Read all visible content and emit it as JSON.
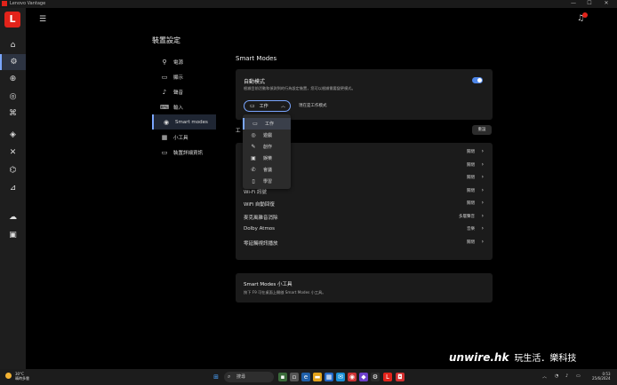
{
  "window": {
    "title": "Lenovo Vantage",
    "brand_letter": "L",
    "min": "—",
    "max": "☐",
    "close": "✕"
  },
  "page": {
    "title": "裝置設定"
  },
  "nav": [
    {
      "icon": "⚲",
      "label": "電源"
    },
    {
      "icon": "▭",
      "label": "顯示"
    },
    {
      "icon": "♪",
      "label": "聲音"
    },
    {
      "icon": "⌨",
      "label": "輸入"
    },
    {
      "icon": "◉",
      "label": "Smart modes"
    },
    {
      "icon": "▦",
      "label": "小工具"
    },
    {
      "icon": "▭",
      "label": "裝置詳細資訊"
    }
  ],
  "section": {
    "title": "Smart Modes"
  },
  "auto_mode": {
    "title": "自動模式",
    "desc": "根據目前活動和偵測到的行為設定裝置，您可以根據需要變更模式。",
    "current_value": "工作",
    "current_desc": "現在是工作模式",
    "toggle_on": true
  },
  "dropdown_options": [
    {
      "icon": "▭",
      "label": "工作"
    },
    {
      "icon": "◎",
      "label": "遊戲"
    },
    {
      "icon": "✎",
      "label": "創作"
    },
    {
      "icon": "▣",
      "label": "娛樂"
    },
    {
      "icon": "✆",
      "label": "會議"
    },
    {
      "icon": "▯",
      "label": "學習"
    }
  ],
  "subsection": {
    "title": "工",
    "reset_label": "重設"
  },
  "settings_rows": [
    {
      "label": "",
      "value": "關閉"
    },
    {
      "label": "",
      "value": "關閉"
    },
    {
      "label": "",
      "value": "關閉"
    },
    {
      "label": "Wi-Fi 訊號",
      "value": "關閉"
    },
    {
      "label": "WiFi 自動回復",
      "value": "關閉"
    },
    {
      "label": "麥克風雜音消除",
      "value": "多層聲音"
    },
    {
      "label": "Dolby Atmos",
      "value": "音樂"
    },
    {
      "label": "零延觸視訊播放",
      "value": "關閉"
    }
  ],
  "widget": {
    "title": "Smart Modes 小工具",
    "desc": "按下 F9 可在桌面上開啟 Smart Modes 小工具。"
  },
  "taskbar": {
    "weather_temp": "30°C",
    "weather_desc": "晴時多雲",
    "search_placeholder": "搜尋",
    "time": "0:53",
    "date": "25/6/2024"
  },
  "watermark": {
    "brand": "unwire.hk",
    "tagline": "玩生活．樂科技"
  },
  "colors": {
    "accent": "#7aa6ff",
    "brand_red": "#e2231a",
    "toggle": "#4e86e8"
  }
}
